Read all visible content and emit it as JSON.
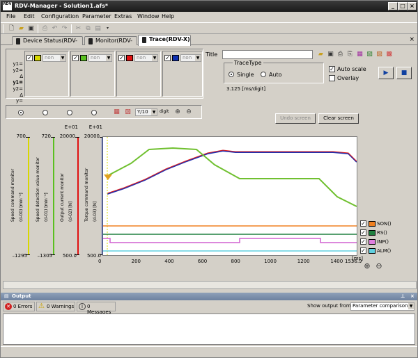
{
  "app": {
    "title": "RDV-Manager - Solution1.afs*",
    "logo": "RDV"
  },
  "menu": [
    "File",
    "Edit",
    "Configuration",
    "Parameter",
    "Extras",
    "Window",
    "Help"
  ],
  "tabs": [
    {
      "label": "Device Status(RDV-X)"
    },
    {
      "label": "Monitor(RDV-X)"
    },
    {
      "label": "Trace(RDV-X)"
    }
  ],
  "channels": {
    "labels": [
      "y1=",
      "y2=",
      "Δ y1=",
      "y1=",
      "y2=",
      "Δ y="
    ],
    "items": [
      {
        "color": "#d8d800",
        "select": "non"
      },
      {
        "color": "#5ac020",
        "select": "non"
      },
      {
        "color": "#e01010",
        "select": "non"
      },
      {
        "color": "#1030b0",
        "select": "non"
      }
    ]
  },
  "title_field": {
    "label": "Title",
    "value": ""
  },
  "trace_type": {
    "label": "TraceType",
    "single": "Single",
    "auto": "Auto",
    "auto_scale": "Auto scale",
    "overlay": "Overlay"
  },
  "rate_text": "3.125 [ms/digit]",
  "divider": {
    "select": "Y/10",
    "unit": "digit"
  },
  "buttons": {
    "undo": "Undo screen",
    "clear": "Clear screen"
  },
  "axes": [
    {
      "exp": "",
      "top": "700",
      "bottom": "–1295",
      "label": "Speed command monitor",
      "unit": "(d-00) [min⁻¹]",
      "color": "#d8d800"
    },
    {
      "exp": "",
      "top": "720",
      "bottom": "–1305",
      "label": "Speed detection value monitor",
      "unit": "(d-01) [min⁻¹]",
      "color": "#5ac020"
    },
    {
      "exp": "E+01",
      "top": "20000",
      "bottom": "500.0",
      "label": "Output current monitor",
      "unit": "(d-02) [N]",
      "color": "#e01010"
    },
    {
      "exp": "E+01",
      "top": "20000",
      "bottom": "500.0",
      "label": "Torque command monitor",
      "unit": "(d-03) [N]",
      "color": "#1030b0"
    }
  ],
  "x_axis": {
    "ticks": [
      "0",
      "200",
      "400",
      "600",
      "800",
      "1000",
      "1200",
      "1400",
      "1536.9"
    ],
    "unit": "[ms]"
  },
  "legend": [
    {
      "label": "SON()",
      "color": "#f08020",
      "checked": "✓"
    },
    {
      "label": "RS()",
      "color": "#208040",
      "checked": "✓"
    },
    {
      "label": "INP()",
      "color": "#e080e0",
      "checked": "✓"
    },
    {
      "label": "ALM()",
      "color": "#60d0e0",
      "checked": "✓"
    }
  ],
  "output": {
    "title": "Output",
    "errors": "0 Errors",
    "warnings": "0 Warnings",
    "messages": "0 Messages",
    "show_from_label": "Show output from:",
    "show_from_value": "Parameter comparison"
  }
}
